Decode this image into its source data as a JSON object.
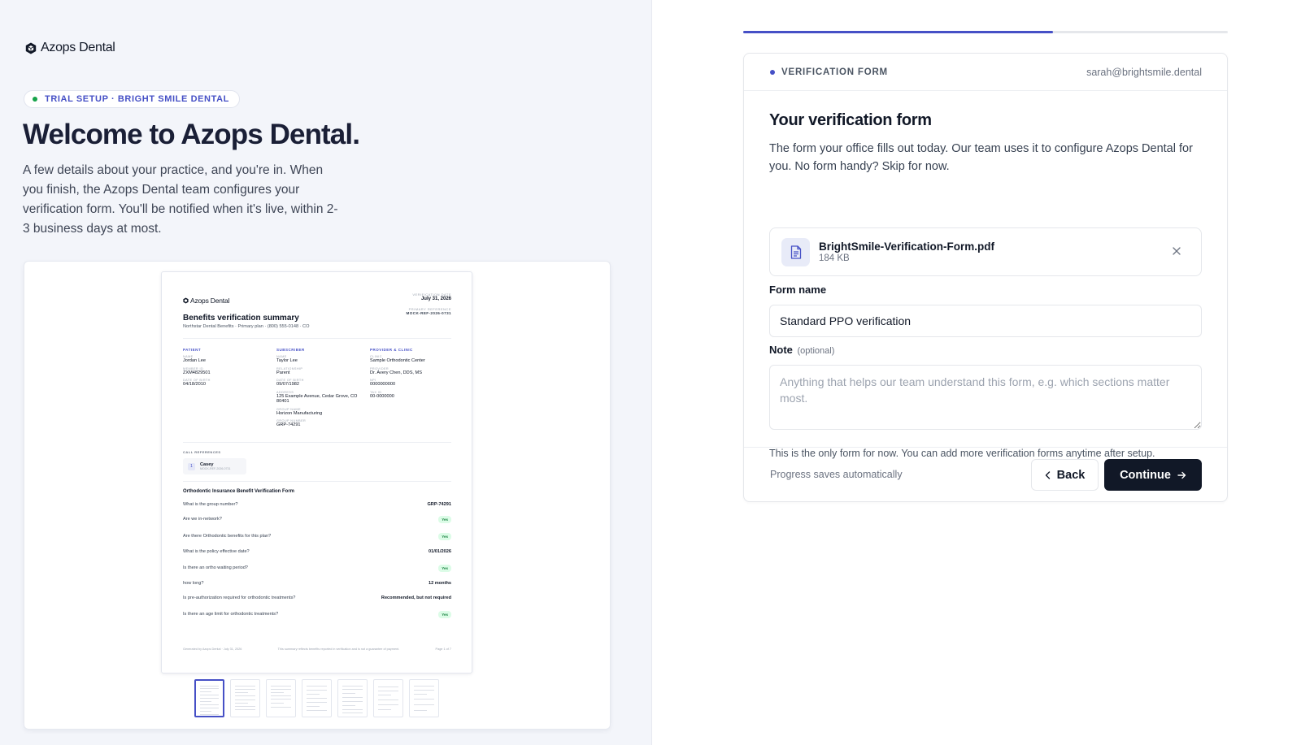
{
  "brand": {
    "name": "Azops Dental"
  },
  "intro": {
    "pill": "TRIAL SETUP · BRIGHT SMILE DENTAL",
    "title": "Welcome to Azops Dental.",
    "body": "A few details about your practice, and you're in. When you finish, the Azops Dental team configures your verification form. You'll be notified when it's live, within 2-3 business days at most."
  },
  "preview": {
    "doc": {
      "logo": "Azops Dental",
      "title": "Benefits verification summary",
      "subtitle": "Northstar Dental Benefits · Primary plan · (800) 555-0148 · CO",
      "meta": [
        {
          "label": "VERIFICATION DATE",
          "value": "July 31, 2026"
        },
        {
          "label": "PRIMARY REFERENCE",
          "value": "MOCK-REF-2026-0731"
        }
      ],
      "columns": [
        {
          "heading": "PATIENT",
          "fields": [
            {
              "label": "NAME",
              "value": "Jordan Lee"
            },
            {
              "label": "MEMBER ID",
              "value": "ZXM4829501"
            },
            {
              "label": "DATE OF BIRTH",
              "value": "04/18/2010"
            }
          ]
        },
        {
          "heading": "SUBSCRIBER",
          "fields": [
            {
              "label": "NAME",
              "value": "Taylor Lee"
            },
            {
              "label": "RELATIONSHIP",
              "value": "Parent"
            },
            {
              "label": "DATE OF BIRTH",
              "value": "09/07/1982"
            },
            {
              "label": "ADDRESS",
              "value": "125 Example Avenue, Cedar Grove, CO 80401"
            },
            {
              "label": "GROUP NAME",
              "value": "Horizon Manufacturing"
            },
            {
              "label": "GROUP NUMBER",
              "value": "GRP-74291"
            }
          ]
        },
        {
          "heading": "PROVIDER & CLINIC",
          "fields": [
            {
              "label": "CLINIC",
              "value": "Sample Orthodontic Center"
            },
            {
              "label": "PROVIDER",
              "value": "Dr. Avery Chen, DDS, MS"
            },
            {
              "label": "NPI",
              "value": "0000000000"
            },
            {
              "label": "TAX ID",
              "value": "00-0000000"
            }
          ]
        }
      ],
      "call_refs_label": "CALL REFERENCES",
      "call_ref": {
        "num": "1",
        "name": "Casey",
        "ref": "MOCK-REF-2026-0731"
      },
      "form_title": "Orthodontic Insurance Benefit Verification Form",
      "questions": [
        {
          "q": "What is the group number?",
          "a": "GRP-74291",
          "badge": false
        },
        {
          "q": "Are we in-network?",
          "a": "Yes",
          "badge": true
        },
        {
          "q": "Are there Orthodontic benefits for this plan?",
          "a": "Yes",
          "badge": true
        },
        {
          "q": "What is the policy effective date?",
          "a": "01/01/2026",
          "badge": false
        },
        {
          "q": "Is there an ortho waiting period?",
          "a": "Yes",
          "badge": true
        },
        {
          "q": "how long?",
          "a": "12 months",
          "badge": false
        },
        {
          "q": "Is pre-authorization required for orthodontic treatments?",
          "a": "Recommended, but not required",
          "badge": false
        },
        {
          "q": "Is there an age limit for orthodontic treatments?",
          "a": "Yes",
          "badge": true
        }
      ],
      "footer_left": "Generated by Azops Dental · July 31, 2026",
      "footer_mid": "This summary reflects benefits reported in verification and is not a guarantee of payment.",
      "footer_right": "Page 1 of 7"
    },
    "page_count": 7,
    "active_page": 1
  },
  "progress": {
    "fraction": 0.64
  },
  "card": {
    "step_label": "VERIFICATION FORM",
    "email": "sarah@brightsmile.dental",
    "title": "Your verification form",
    "description": "The form your office fills out today. Our team uses it to configure Azops Dental for you. No form handy? Skip for now.",
    "file": {
      "name": "BrightSmile-Verification-Form.pdf",
      "size": "184 KB"
    },
    "form_name_label": "Form name",
    "form_name_value": "Standard PPO verification",
    "note_label": "Note",
    "note_optional": "(optional)",
    "note_placeholder": "Anything that helps our team understand this form, e.g. which sections matter most.",
    "hint": "This is the only form for now. You can add more verification forms anytime after setup.",
    "saves": "Progress saves automatically",
    "back_label": "Back",
    "continue_label": "Continue"
  },
  "colors": {
    "accent": "#4650c6",
    "primary_button": "#111827",
    "success": "#16a34a"
  }
}
